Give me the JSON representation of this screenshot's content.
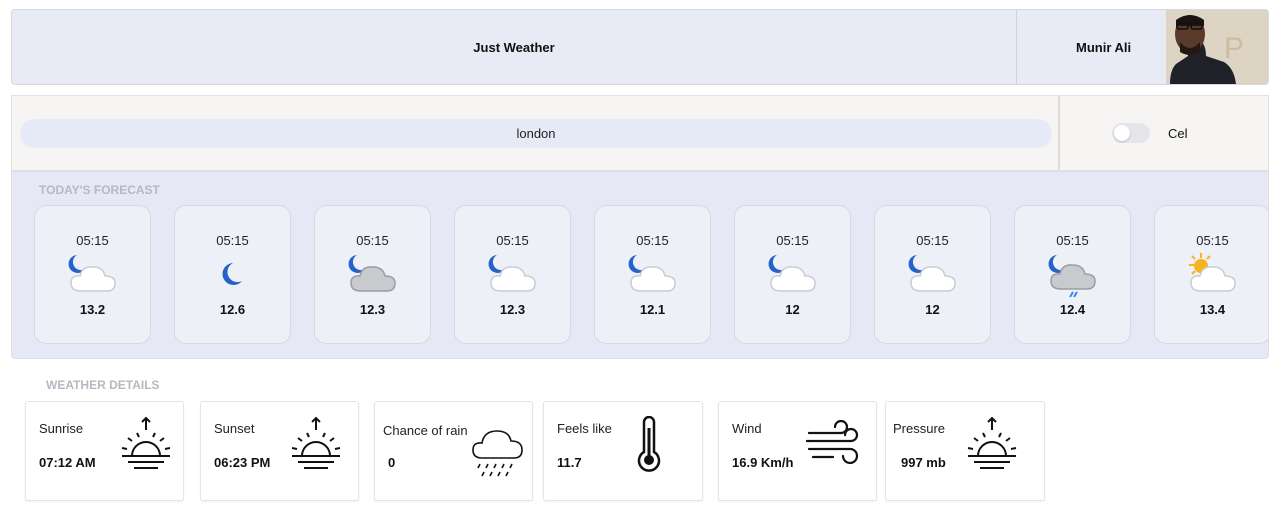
{
  "header": {
    "title": "Just Weather",
    "user_name": "Munir Ali"
  },
  "search": {
    "value": "london"
  },
  "unit_toggle": {
    "label": "Cel",
    "checked": false
  },
  "forecast": {
    "label": "TODAY'S FORECAST",
    "hours": [
      {
        "time": "05:15",
        "temp": "13.2",
        "icon": "night-cloud-icon"
      },
      {
        "time": "05:15",
        "temp": "12.6",
        "icon": "moon-icon"
      },
      {
        "time": "05:15",
        "temp": "12.3",
        "icon": "night-dark-cloud-icon"
      },
      {
        "time": "05:15",
        "temp": "12.3",
        "icon": "night-cloud-icon"
      },
      {
        "time": "05:15",
        "temp": "12.1",
        "icon": "night-cloud-icon"
      },
      {
        "time": "05:15",
        "temp": "12",
        "icon": "night-cloud-icon"
      },
      {
        "time": "05:15",
        "temp": "12",
        "icon": "night-cloud-icon"
      },
      {
        "time": "05:15",
        "temp": "12.4",
        "icon": "night-rain-icon"
      },
      {
        "time": "05:15",
        "temp": "13.4",
        "icon": "sun-cloud-icon"
      }
    ]
  },
  "details": {
    "label": "WEATHER DETAILS",
    "items": [
      {
        "label": "Sunrise",
        "value": "07:12 AM",
        "icon": "sunrise-icon"
      },
      {
        "label": "Sunset",
        "value": "06:23 PM",
        "icon": "sunset-icon"
      },
      {
        "label": "Chance of rain",
        "value": "0",
        "icon": "rain-cloud-icon"
      },
      {
        "label": "Feels like",
        "value": "11.7",
        "icon": "thermometer-icon"
      },
      {
        "label": "Wind",
        "value": "16.9 Km/h",
        "icon": "wind-icon"
      },
      {
        "label": "Pressure",
        "value": "997 mb",
        "icon": "pressure-icon"
      }
    ]
  },
  "colors": {
    "accent_blue": "#2563c9",
    "panel_bg": "#e6e9f5",
    "sun": "#f5b41e"
  }
}
